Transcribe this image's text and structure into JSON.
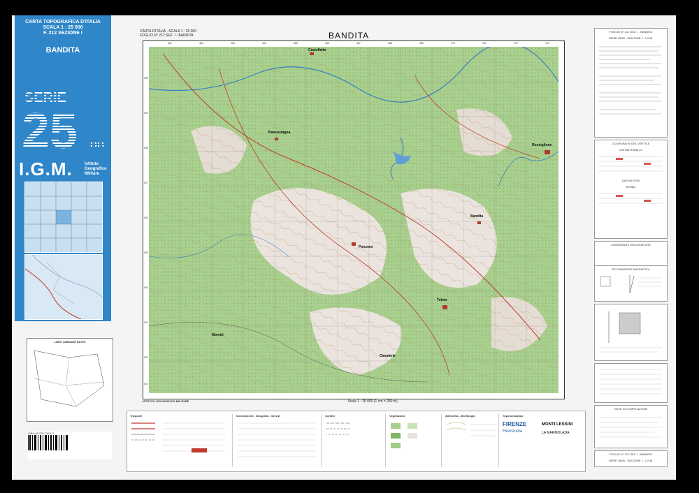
{
  "cover": {
    "line1": "CARTA TOPOGRAFICA D'ITALIA",
    "line2": "SCALA 1 : 25 000",
    "line3": "F. 212 SEZIONE I",
    "sheet_name": "BANDITA",
    "serie_label": "SERIE",
    "serie_number": "25",
    "serie_suffix": "DB",
    "institute_abbr": "I.G.M.",
    "institute_line1": "Istituto",
    "institute_line2": "Geografico",
    "institute_line3": "Militare"
  },
  "header": {
    "left_line1": "CARTA D'ITALIA - SCALA 1 : 25 000",
    "left_line2": "FOGLIO N° 212 SEZ. I - BANDITA",
    "title": "BANDITA"
  },
  "map": {
    "towns": [
      "Castelletto",
      "Rossiglione",
      "Ponzone",
      "Toleto",
      "Piancastagna",
      "Bandita",
      "Moretti",
      "Cimaferle"
    ],
    "scale_text": "Scala 1 : 25 000 (1 cm = 250 m)",
    "institute_text": "ISTITUTO GEOGRAFICO MILITARE",
    "grid_top": [
      "461",
      "462",
      "463",
      "464",
      "465",
      "466",
      "467",
      "468",
      "469",
      "470",
      "471",
      "472",
      "473"
    ],
    "grid_side": [
      "930",
      "929",
      "928",
      "927",
      "926",
      "925",
      "924",
      "923",
      "922",
      "921"
    ]
  },
  "right": {
    "header_line1": "FOGLIO N° 212 SEZ. I - BANDITA",
    "header_line2": "SERIE 25DB - EDIZIONE 1 - I.G.M.",
    "datum_title": "COORDINATE DEL VERTICE",
    "panels": [
      "DATUM ROMA 40",
      "DATUM ED50",
      "WGS84",
      "COORDINATE GEOGRAFICHE",
      "DECLINAZIONE MAGNETICA",
      "NOTE DI COMPILAZIONE"
    ],
    "footer_line1": "FOGLIO N° 212 SEZ. I - BANDITA",
    "footer_line2": "SERIE 25DB - EDIZIONE 1 - I.G.M."
  },
  "legend": {
    "sections": [
      "Trasporti",
      "Insediamenti - Idrografia - Servizi",
      "Confini",
      "Vegetazione",
      "Altimetria - Morfologia",
      "Particolari fotografici",
      "Toponomastica"
    ],
    "toponyms": [
      "FIRENZE",
      "Firenzuola",
      "MONTI LESSINI",
      "LA MARMOLADA"
    ]
  },
  "admin": {
    "title": "LIMITI AMMINISTRATIVI"
  },
  "isbn": "ISBN 88-525-7604-3",
  "colors": {
    "cover_blue": "#2f86c8",
    "map_green": "#9fcc86",
    "map_light": "#e8e2dc"
  }
}
